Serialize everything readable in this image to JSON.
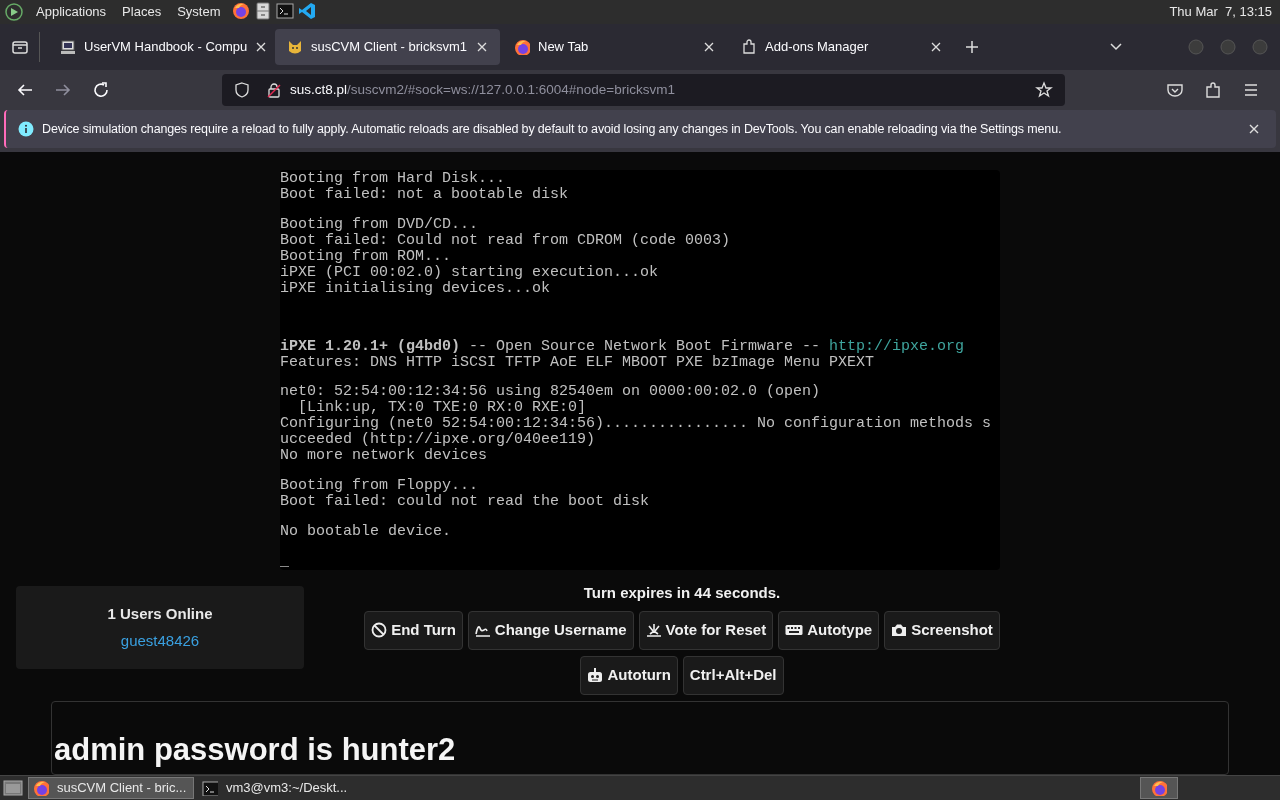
{
  "top_panel": {
    "menus": [
      "Applications",
      "Places",
      "System"
    ],
    "launchers": [
      {
        "kind": "firefox"
      },
      {
        "kind": "files"
      },
      {
        "kind": "terminal"
      },
      {
        "kind": "code"
      }
    ],
    "clock": "Thu Mar  7, 13:15"
  },
  "tabs": [
    {
      "title": "UserVM Handbook - Compu",
      "kind": "computer",
      "selected": false
    },
    {
      "title": "susCVM Client - bricksvm1",
      "kind": "cat",
      "selected": true
    },
    {
      "title": "New Tab",
      "kind": "firefox",
      "selected": false
    },
    {
      "title": "Add-ons Manager",
      "kind": "puzzle",
      "selected": false
    }
  ],
  "address_bar": {
    "host": "sus.ct8.pl",
    "path": "/suscvm2/#sock=ws://127.0.0.1:6004#node=bricksvm1"
  },
  "notification": {
    "text": "Device simulation changes require a reload to fully apply. Automatic reloads are disabled by default to avoid losing any changes in DevTools. You can enable reloading via the Settings menu."
  },
  "vm_screen": {
    "lines": [
      {
        "kind": "text",
        "text": "Booting from Hard Disk..."
      },
      {
        "kind": "text",
        "text": "Boot failed: not a bootable disk"
      },
      {
        "kind": "blank"
      },
      {
        "kind": "text",
        "text": "Booting from DVD/CD..."
      },
      {
        "kind": "text",
        "text": "Boot failed: Could not read from CDROM (code 0003)"
      },
      {
        "kind": "text",
        "text": "Booting from ROM..."
      },
      {
        "kind": "text",
        "text": "iPXE (PCI 00:02.0) starting execution...ok"
      },
      {
        "kind": "text",
        "text": "iPXE initialising devices...ok"
      },
      {
        "kind": "blank"
      },
      {
        "kind": "blank"
      },
      {
        "kind": "blank"
      },
      {
        "kind": "link",
        "text": "**iPXE 1.20.1+ (g4bd0)** -- Open Source Network Boot Firmware -- ",
        "link": "http://ipxe.org"
      },
      {
        "kind": "text",
        "text": "Features: DNS HTTP iSCSI TFTP AoE ELF MBOOT PXE bzImage Menu PXEXT"
      },
      {
        "kind": "blank"
      },
      {
        "kind": "text",
        "text": "net0: 52:54:00:12:34:56 using 82540em on 0000:00:02.0 (open)"
      },
      {
        "kind": "text",
        "text": "  [Link:up, TX:0 TXE:0 RX:0 RXE:0]"
      },
      {
        "kind": "text",
        "text": "Configuring (net0 52:54:00:12:34:56)................ No configuration methods s"
      },
      {
        "kind": "text",
        "text": "ucceeded (http://ipxe.org/040ee119)"
      },
      {
        "kind": "text",
        "text": "No more network devices"
      },
      {
        "kind": "blank"
      },
      {
        "kind": "text",
        "text": "Booting from Floppy..."
      },
      {
        "kind": "text",
        "text": "Boot failed: could not read the boot disk"
      },
      {
        "kind": "blank"
      },
      {
        "kind": "text",
        "text": "No bootable device."
      },
      {
        "kind": "blank"
      },
      {
        "kind": "text",
        "text": "_"
      }
    ]
  },
  "users_panel": {
    "title": "1 Users Online",
    "users": [
      "guest48426"
    ]
  },
  "turn_status": "Turn expires in 44 seconds.",
  "buttons": [
    [
      {
        "label": "End Turn",
        "kind": "ban"
      },
      {
        "label": "Change Username",
        "kind": "signature"
      },
      {
        "label": "Vote for Reset",
        "kind": "burst"
      },
      {
        "label": "Autotype",
        "kind": "keyboard"
      },
      {
        "label": "Screenshot",
        "kind": "camera"
      }
    ],
    [
      {
        "label": "Autoturn",
        "kind": "robot"
      },
      {
        "label": "Ctrl+Alt+Del",
        "kind": "plain"
      }
    ]
  ],
  "message": {
    "heading": "admin password is hunter2"
  },
  "taskbar": {
    "tasks": [
      {
        "title": "susCVM Client - bric...",
        "kind": "firefox",
        "selected": true
      },
      {
        "title": "vm3@vm3:~/Deskt...",
        "kind": "terminal",
        "selected": false
      }
    ],
    "tray": [
      {
        "kind": "firefox"
      }
    ]
  }
}
